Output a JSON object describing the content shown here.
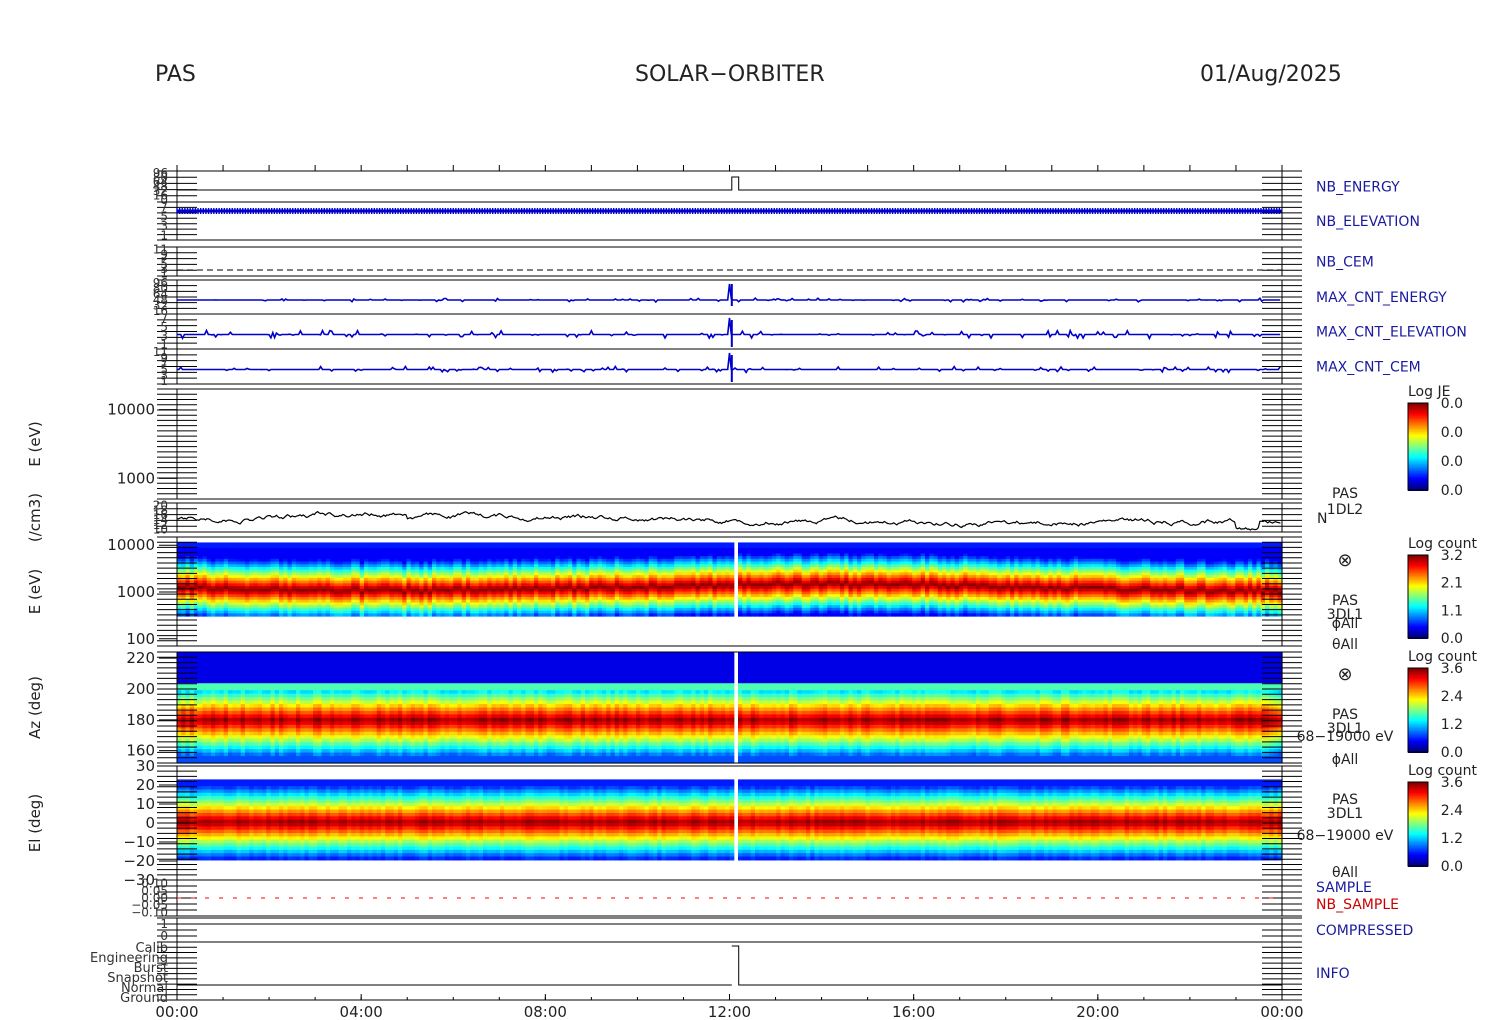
{
  "header": {
    "left": "PAS",
    "center": "SOLAR−ORBITER",
    "right": "01/Aug/2025"
  },
  "colors": {
    "axis": "#000000",
    "trace_blue": "#0000cc",
    "trace_black": "#000000",
    "trace_red": "#ff0000",
    "label_blue": "#1a1aa0",
    "label_red": "#cc0000"
  },
  "time_axis": {
    "range_hours": [
      0,
      24
    ],
    "tick_hours": [
      0,
      4,
      8,
      12,
      16,
      20,
      24
    ],
    "tick_labels": [
      "00:00",
      "04:00",
      "08:00",
      "12:00",
      "16:00",
      "20:00",
      "00:00"
    ]
  },
  "chart_data": [
    {
      "type": "line",
      "id": "nb_energy",
      "label": "NB_ENERGY",
      "ytick_labels": [
        "96",
        "80",
        "64",
        "48",
        "32",
        "16",
        "0"
      ]
    },
    {
      "type": "line",
      "id": "nb_elevation",
      "label": "NB_ELEVATION",
      "ytick_labels": [
        "7",
        "5",
        "3",
        "1"
      ]
    },
    {
      "type": "line",
      "id": "nb_cem",
      "label": "NB_CEM",
      "ytick_labels": [
        "11",
        "9",
        "7",
        "5",
        "3",
        "1"
      ]
    },
    {
      "type": "line",
      "id": "max_cnt_energy",
      "label": "MAX_CNT_ENERGY",
      "ytick_labels": [
        "96",
        "80",
        "64",
        "48",
        "32",
        "16"
      ]
    },
    {
      "type": "line",
      "id": "max_cnt_elevation",
      "label": "MAX_CNT_ELEVATION",
      "ytick_labels": [
        "7",
        "5",
        "3",
        "1"
      ]
    },
    {
      "type": "line",
      "id": "max_cnt_cem",
      "label": "MAX_CNT_CEM",
      "ytick_labels": [
        "11",
        "9",
        "7",
        "5",
        "3",
        "1"
      ]
    },
    {
      "type": "heatmap",
      "id": "je_empty",
      "ylabel": "E (eV)",
      "yscale": "log",
      "ylim": [
        500,
        20000
      ],
      "yticks": [
        1000,
        10000
      ],
      "ytick_labels": [
        "1000",
        "10000"
      ],
      "data": "empty",
      "colorbar": {
        "title": "Log JE",
        "tick_labels": [
          "0.0",
          "0.0",
          "0.0",
          "0.0"
        ]
      }
    },
    {
      "type": "line",
      "id": "density",
      "ylabel": "(/cm3)",
      "ylim": [
        10,
        20
      ],
      "ytick_labels": [
        "20",
        "18",
        "16",
        "14",
        "12",
        "10"
      ],
      "label_lines": [
        "PAS",
        "1DL2"
      ],
      "series_tag": "N"
    },
    {
      "type": "heatmap",
      "id": "energy_spectrogram",
      "ylabel": "E (eV)",
      "yscale": "log",
      "ylim": [
        70,
        15000
      ],
      "yticks": [
        100,
        1000,
        10000
      ],
      "ytick_labels": [
        "100",
        "1000",
        "10000"
      ],
      "label_lines": [
        "PAS",
        "3DL1",
        "ϕAll",
        "θAll"
      ],
      "symbol": "⊗",
      "colorbar": {
        "title": "Log count",
        "vmin": 0.0,
        "vmax": 3.2,
        "tick_labels": [
          "3.2",
          "2.1",
          "1.1",
          "0.0"
        ]
      }
    },
    {
      "type": "heatmap",
      "id": "azimuth_spectrogram",
      "ylabel": "Az (deg)",
      "ylim": [
        152,
        224
      ],
      "yticks": [
        160,
        180,
        200,
        220
      ],
      "ytick_labels": [
        "160",
        "180",
        "200",
        "220"
      ],
      "label_lines": [
        "PAS",
        "3DL1",
        "68−19000 eV",
        "ϕAll"
      ],
      "symbol": "⊗",
      "colorbar": {
        "title": "Log count",
        "vmin": 0.0,
        "vmax": 3.6,
        "tick_labels": [
          "3.6",
          "2.4",
          "1.2",
          "0.0"
        ]
      }
    },
    {
      "type": "heatmap",
      "id": "elevation_spectrogram",
      "ylabel": "El (deg)",
      "ylim": [
        -30,
        30
      ],
      "yticks": [
        -30,
        -20,
        -10,
        0,
        10,
        20,
        30
      ],
      "ytick_labels": [
        "−30",
        "−20",
        "−10",
        "0",
        "10",
        "20",
        "30"
      ],
      "label_lines": [
        "PAS",
        "3DL1",
        "68−19000 eV",
        "θAll"
      ],
      "colorbar": {
        "title": "Log count",
        "vmin": 0.0,
        "vmax": 3.6,
        "tick_labels": [
          "3.6",
          "2.4",
          "1.2",
          "0.0"
        ]
      }
    },
    {
      "type": "line",
      "id": "sample",
      "labels": [
        "SAMPLE",
        "NB_SAMPLE"
      ],
      "ytick_labels": [
        "0.10",
        "0.05",
        "0.00",
        "−0.05",
        "−0.10"
      ]
    },
    {
      "type": "line",
      "id": "compressed",
      "label": "COMPRESSED",
      "ytick_labels": [
        "1",
        "0"
      ]
    },
    {
      "type": "line",
      "id": "info",
      "label": "INFO",
      "ytick_labels": [
        "Calib",
        "Engineering",
        "Burst",
        "Snapshot",
        "Normal",
        "Ground"
      ]
    }
  ]
}
